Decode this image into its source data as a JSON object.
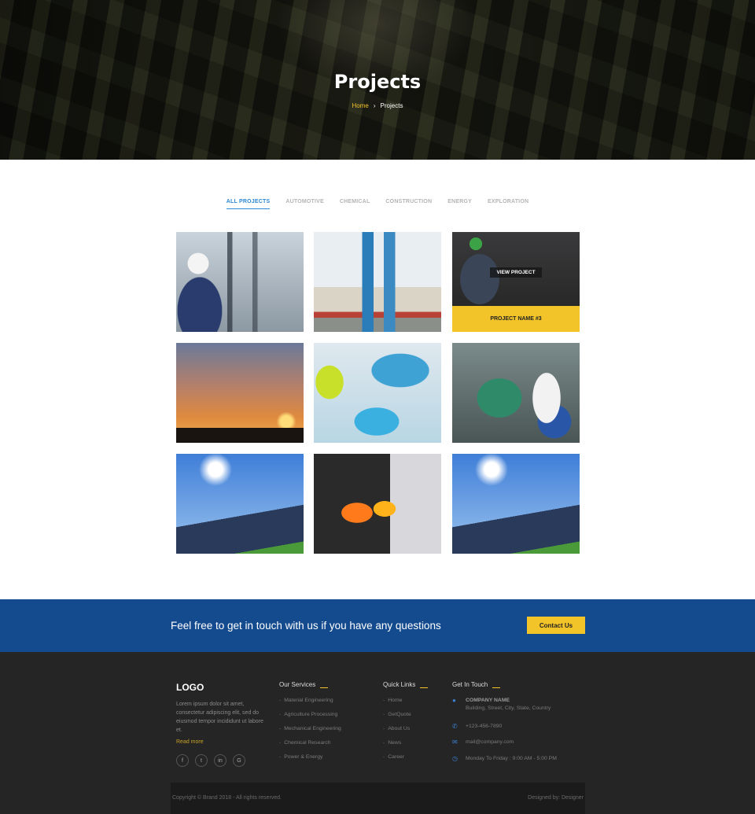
{
  "hero": {
    "title": "Projects",
    "breadcrumb": {
      "home": "Home",
      "separator": "›",
      "current": "Projects"
    }
  },
  "filters": [
    {
      "label": "ALL PROJECTS",
      "active": true
    },
    {
      "label": "AUTOMOTIVE",
      "active": false
    },
    {
      "label": "CHEMICAL",
      "active": false
    },
    {
      "label": "CONSTRUCTION",
      "active": false
    },
    {
      "label": "ENERGY",
      "active": false
    },
    {
      "label": "EXPLORATION",
      "active": false
    }
  ],
  "projects": {
    "hover_tile": {
      "view_label": "VIEW PROJECT",
      "name": "PROJECT NAME #3"
    }
  },
  "cta": {
    "text": "Feel free to get in touch with us if you have any questions",
    "button": "Contact Us"
  },
  "footer": {
    "logo": "LOGO",
    "about": "Lorem ipsum dolor sit amet, consectetur adipiscing elit, sed do eiusmod tempor incididunt ut labore et.",
    "read_more": "Read more",
    "social": [
      {
        "icon": "facebook-icon",
        "glyph": "f"
      },
      {
        "icon": "twitter-icon",
        "glyph": "t"
      },
      {
        "icon": "linkedin-icon",
        "glyph": "in"
      },
      {
        "icon": "google-icon",
        "glyph": "G"
      }
    ],
    "services": {
      "title": "Our Services",
      "items": [
        "Material Engineering",
        "Agriculture Processing",
        "Mechanical Engineering",
        "Chemical Research",
        "Power & Energy"
      ]
    },
    "quick_links": {
      "title": "Quick Links",
      "items": [
        "Home",
        "GetQuote",
        "About Us",
        "News",
        "Career"
      ]
    },
    "contact": {
      "title": "Get In Touch",
      "company": "COMPANY NAME",
      "address": "Building, Street, City, State, Country",
      "phone": "+123-456-7890",
      "email": "mail@company.com",
      "hours": "Monday To Friday : 9:00 AM - 5:00 PM"
    },
    "copyright": "Copyright © Brand 2018 - All rights reserved.",
    "designed_by": "Designed by: Designer"
  },
  "colors": {
    "accent": "#f3c42a",
    "brand_blue": "#144b8f",
    "tab_active": "#2c87d6",
    "footer_bg": "#252525"
  }
}
